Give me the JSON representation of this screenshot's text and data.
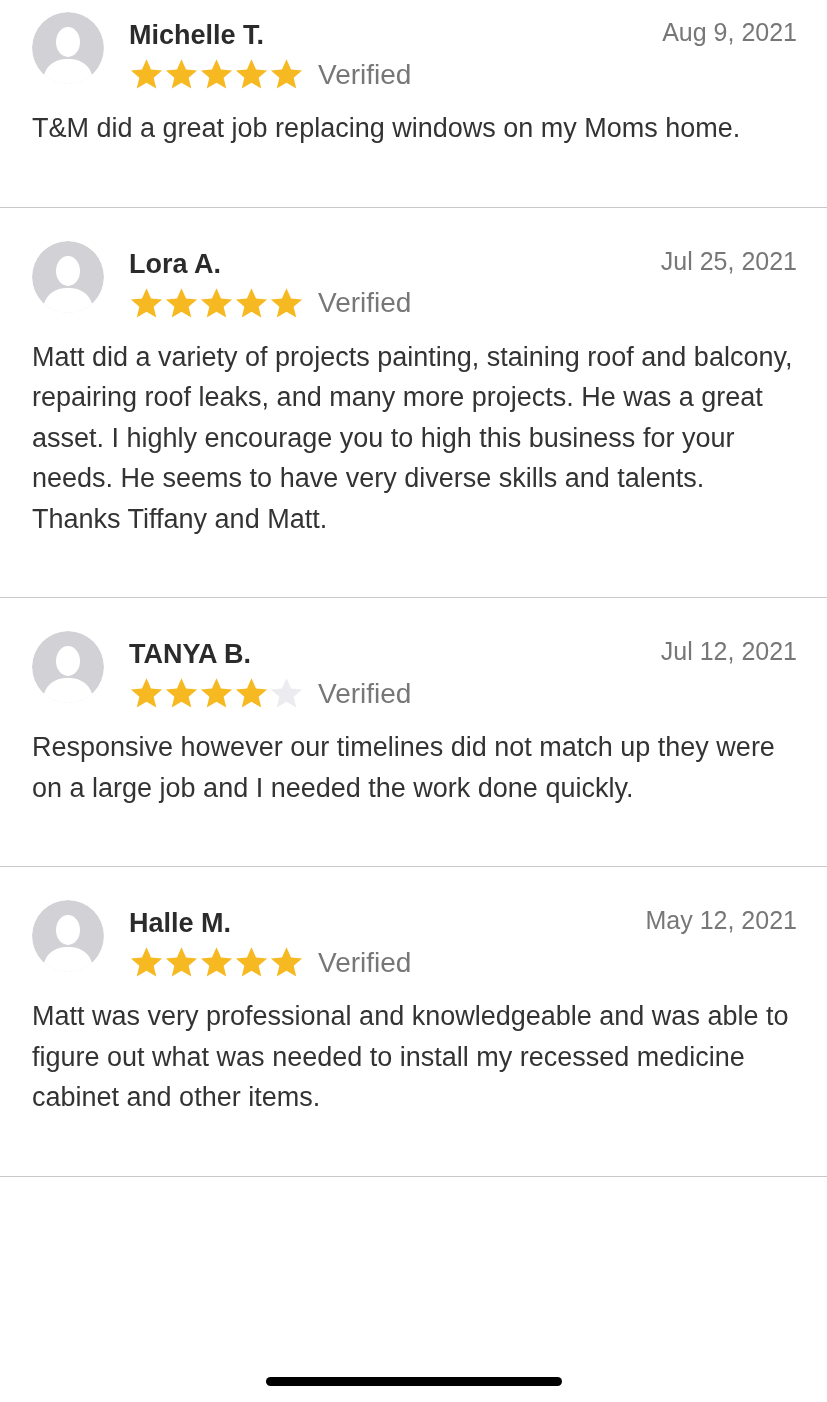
{
  "reviews": [
    {
      "name": "Michelle T.",
      "date": "Aug 9, 2021",
      "stars": 5,
      "badge": "Verified",
      "text": "T&M did a great job replacing windows on my Moms home."
    },
    {
      "name": "Lora A.",
      "date": "Jul 25, 2021",
      "stars": 5,
      "badge": "Verified",
      "text": "Matt did a variety of projects painting, staining roof and balcony, repairing roof leaks, and many more projects. He was a great asset. I highly encourage you to high this business for your needs. He seems to have very diverse skills and talents. Thanks Tiffany and Matt."
    },
    {
      "name": "TANYA B.",
      "date": "Jul 12, 2021",
      "stars": 4,
      "badge": "Verified",
      "text": "Responsive however our timelines did not match up they were on a large job and I needed the work done quickly."
    },
    {
      "name": "Halle M.",
      "date": "May 12, 2021",
      "stars": 5,
      "badge": "Verified",
      "text": "Matt was very professional and knowledgeable and was able to figure out what was needed to install my recessed medicine cabinet and other items."
    }
  ]
}
